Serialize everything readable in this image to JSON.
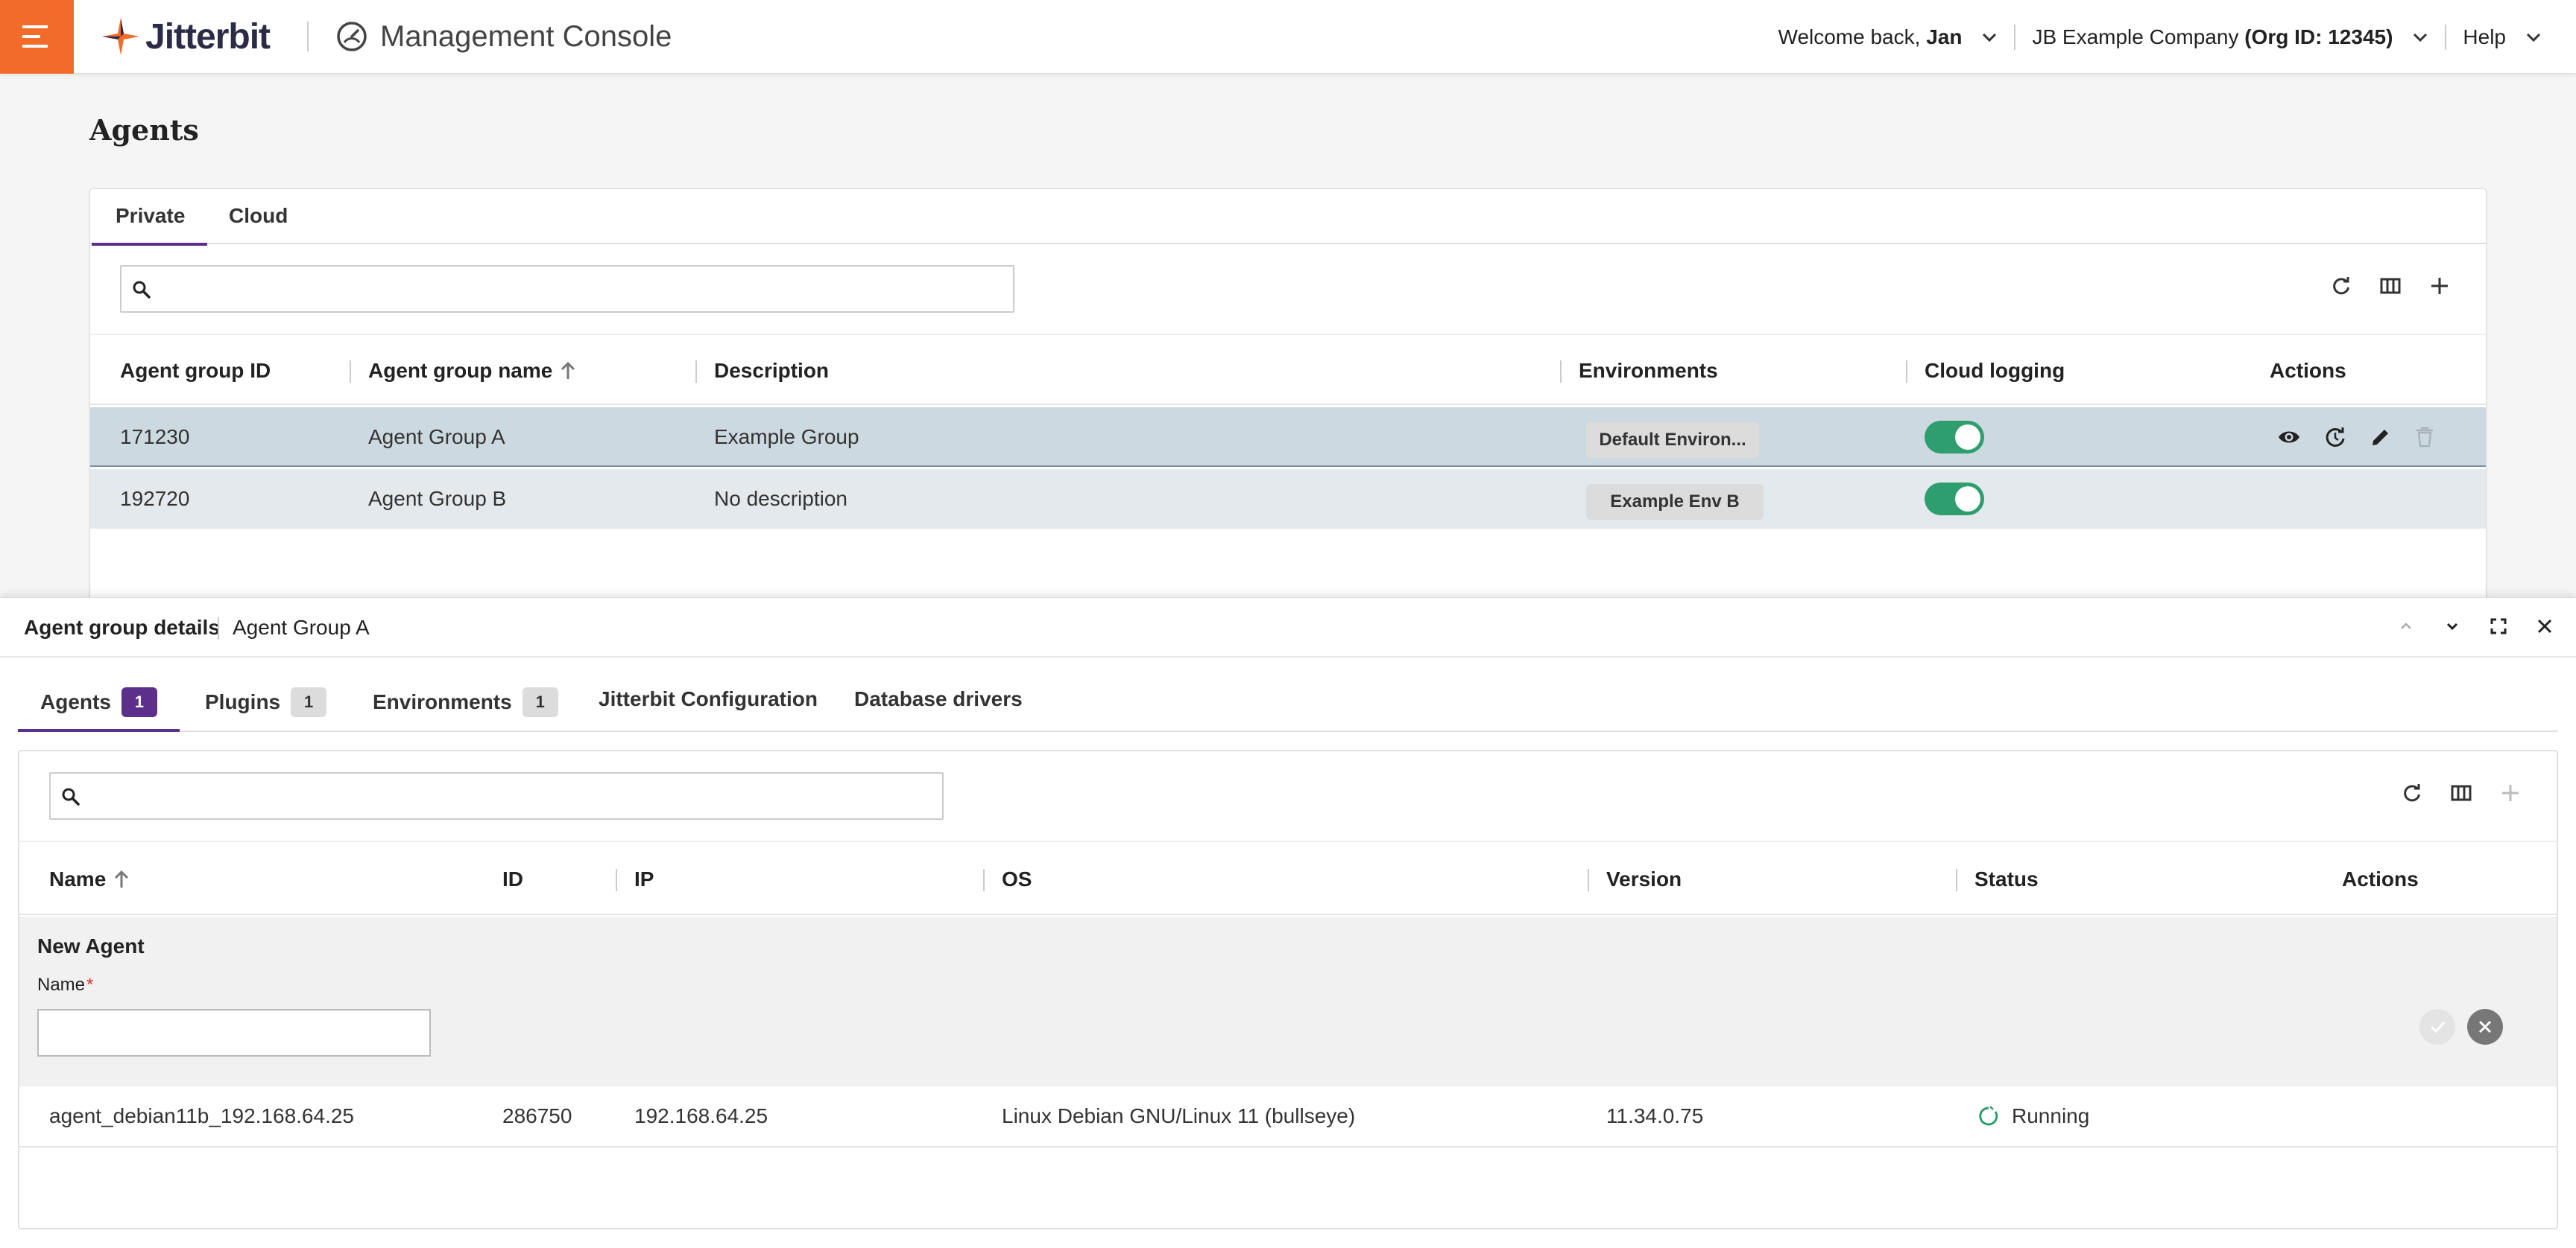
{
  "header": {
    "brand": "Jitterbit",
    "app_title": "Management Console",
    "welcome_prefix": "Welcome back,",
    "user": "Jan",
    "company": "JB Example Company",
    "org": "(Org ID: 12345)",
    "help": "Help",
    "accent": "#f26b2a"
  },
  "page": {
    "title": "Agents",
    "tabs": [
      {
        "label": "Private",
        "active": true
      },
      {
        "label": "Cloud",
        "active": false
      }
    ],
    "search_placeholder": "",
    "columns": [
      "Agent group ID",
      "Agent group name",
      "Description",
      "Environments",
      "Cloud logging",
      "Actions"
    ],
    "rows": [
      {
        "id": "171230",
        "name": "Agent Group A",
        "description": "Example Group",
        "environment": "Default Environ...",
        "cloud_logging": true,
        "selected": true
      },
      {
        "id": "192720",
        "name": "Agent Group B",
        "description": "No description",
        "environment": "Example Env B",
        "cloud_logging": true,
        "selected": false
      }
    ]
  },
  "details": {
    "title": "Agent group details",
    "group_name": "Agent Group A",
    "tabs": [
      {
        "label": "Agents",
        "badge": "1",
        "active": true
      },
      {
        "label": "Plugins",
        "badge": "1",
        "active": false
      },
      {
        "label": "Environments",
        "badge": "1",
        "active": false
      },
      {
        "label": "Jitterbit Configuration",
        "badge": null,
        "active": false
      },
      {
        "label": "Database drivers",
        "badge": null,
        "active": false
      }
    ],
    "search_placeholder": "",
    "columns": [
      "Name",
      "ID",
      "IP",
      "OS",
      "Version",
      "Status",
      "Actions"
    ],
    "new_agent": {
      "title": "New Agent",
      "name_label": "Name",
      "required_mark": "*",
      "name_value": ""
    },
    "agents": [
      {
        "name": "agent_debian11b_192.168.64.25",
        "id": "286750",
        "ip": "192.168.64.25",
        "os": "Linux Debian GNU/Linux 11 (bullseye)",
        "version": "11.34.0.75",
        "status": "Running"
      }
    ]
  },
  "colors": {
    "purple": "#5b2f8a",
    "toggle_on": "#2e9e6e",
    "row_selected": "#cdd9e0",
    "status_running": "#2e9e6e"
  }
}
